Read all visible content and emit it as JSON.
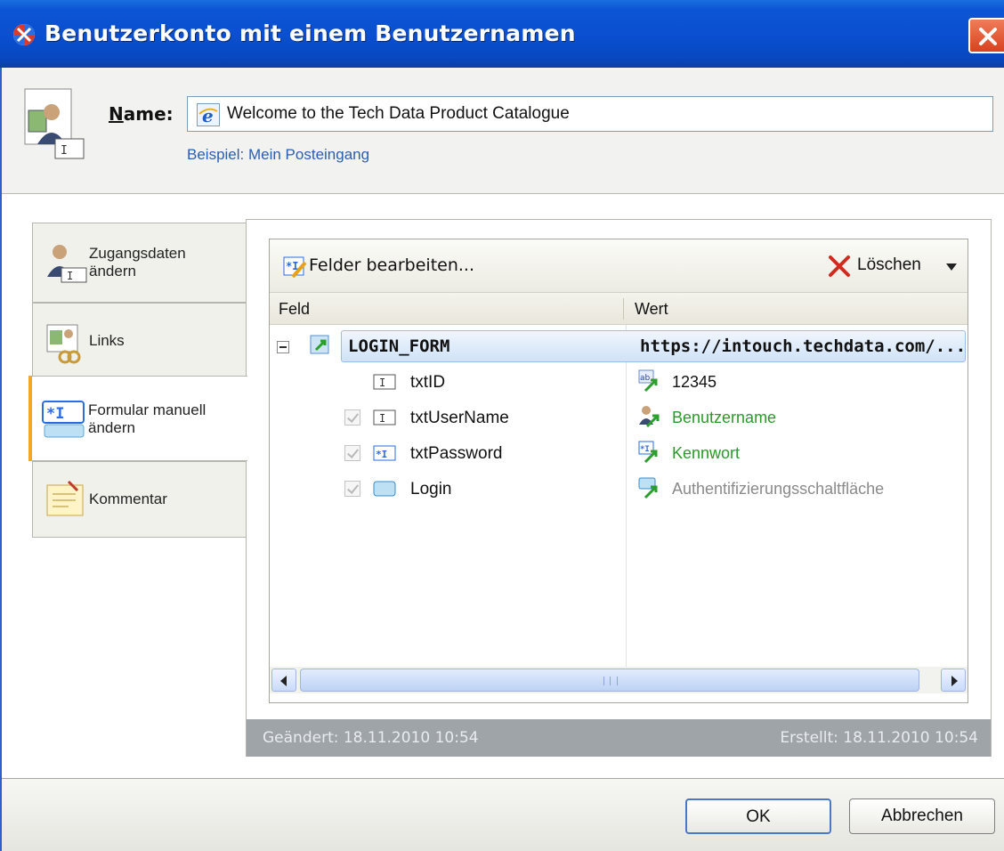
{
  "window": {
    "title": "Benutzerkonto mit einem Benutzernamen",
    "close_icon": "close-icon",
    "app_icon": "roboform-icon"
  },
  "header": {
    "name_label_u": "N",
    "name_label_rest": "ame:",
    "name_value": "Welcome to the Tech Data Product Catalogue",
    "name_value_icon": "internet-explorer-icon",
    "example_text": "Beispiel: Mein Posteingang",
    "header_icon": "user-account-icon"
  },
  "tabs": [
    {
      "label_line1": "Zugangsdaten",
      "label_line2": "ändern",
      "icon": "user-credentials-icon",
      "active": false
    },
    {
      "label_line1": "Links",
      "label_line2": "",
      "icon": "links-icon",
      "active": false
    },
    {
      "label_line1": "Formular manuell",
      "label_line2": "ändern",
      "icon": "form-field-icon",
      "active": true
    },
    {
      "label_line1": "Kommentar",
      "label_line2": "",
      "icon": "comment-icon",
      "active": false
    }
  ],
  "toolbar": {
    "edit_label": "Felder bearbeiten...",
    "edit_icon": "edit-fields-icon",
    "delete_label": "Löschen",
    "delete_icon": "delete-x-icon"
  },
  "columns": {
    "field": "Feld",
    "value": "Wert"
  },
  "rows": [
    {
      "name": "LOGIN_FORM",
      "value": "https://intouch.techdata.com/...",
      "icon": "form-icon",
      "value_icon": "",
      "checked": false
    },
    {
      "name": "txtID",
      "value": "12345",
      "icon": "text-field-icon",
      "value_icon": "text-value-icon",
      "checked": false
    },
    {
      "name": "txtUserName",
      "value": "Benutzername",
      "icon": "text-field-icon",
      "value_icon": "username-icon",
      "checked": true
    },
    {
      "name": "txtPassword",
      "value": "Kennwort",
      "icon": "password-field-icon",
      "value_icon": "password-icon",
      "checked": true
    },
    {
      "name": "Login",
      "value": "Authentifizierungsschaltfläche",
      "icon": "button-field-icon",
      "value_icon": "auth-button-icon",
      "checked": true
    }
  ],
  "status": {
    "modified": "Geändert: 18.11.2010 10:54",
    "created": "Erstellt: 18.11.2010 10:54"
  },
  "buttons": {
    "ok": "OK",
    "cancel": "Abbrechen"
  },
  "colors": {
    "titlebar": "#0a4fd0",
    "active_tab_accent": "#f5a623",
    "value_green": "#2a9a2a",
    "value_gray": "#8a8a8a",
    "status_bar": "#9ea4a8"
  }
}
